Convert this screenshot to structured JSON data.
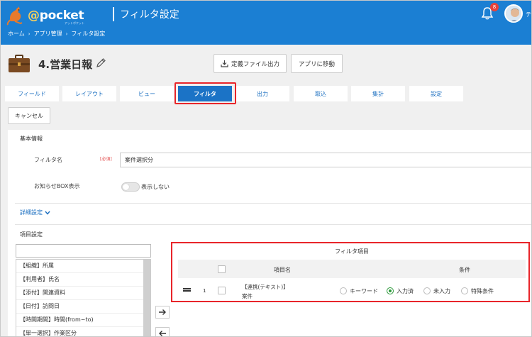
{
  "header": {
    "logo_text": "@pocket",
    "logo_sub": "アットポケット",
    "app_title": "フィルタ設定",
    "breadcrumb": [
      "ホーム",
      "アプリ管理",
      "フィルタ設定"
    ],
    "notification_count": "8",
    "user_name_partial": "テ"
  },
  "page": {
    "title": "4.営業日報",
    "export_button": "定義ファイル出力",
    "goto_app_button": "アプリに移動",
    "cancel_button": "キャンセル"
  },
  "tabs": [
    {
      "label": "フィールド",
      "active": false
    },
    {
      "label": "レイアウト",
      "active": false
    },
    {
      "label": "ビュー",
      "active": false
    },
    {
      "label": "フィルタ",
      "active": true
    },
    {
      "label": "出力",
      "active": false
    },
    {
      "label": "取込",
      "active": false
    },
    {
      "label": "集計",
      "active": false
    },
    {
      "label": "設定",
      "active": false
    }
  ],
  "basic_info": {
    "section_title": "基本情報",
    "filter_name_label": "フィルタ名",
    "required_label": "[必須]",
    "filter_name_value": "案件選択分",
    "notice_box_label": "お知らせBOX表示",
    "notice_toggle_label": "表示しない",
    "detail_link": "詳細設定"
  },
  "item_settings": {
    "section_title": "項目設定",
    "search_value": "",
    "available_items": [
      "【組織】所属",
      "【利用者】氏名",
      "【添付】関連資料",
      "【日付】訪問日",
      "【時間期間】時間(from~to)",
      "【単一選択】作業区分"
    ]
  },
  "filter_items": {
    "title": "フィルタ項目",
    "col_item_name": "項目名",
    "col_condition": "条件",
    "rows": [
      {
        "index": "1",
        "name_line1": "【連携(テキスト)】",
        "name_line2": "案件",
        "options": [
          "キーワード",
          "入力済",
          "未入力",
          "特殊条件"
        ],
        "selected": "入力済"
      }
    ]
  },
  "colors": {
    "header_bg": "#1b7fd3",
    "tab_active": "#1b73c6",
    "highlight_red": "#e8252a",
    "radio_green": "#2e9a3c"
  }
}
